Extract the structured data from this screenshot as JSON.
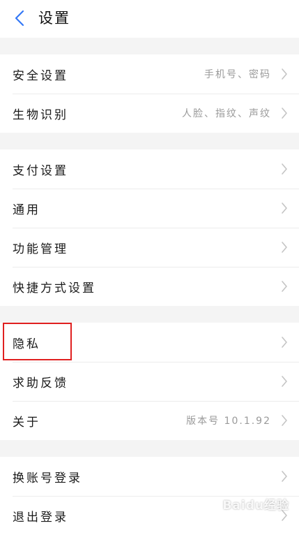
{
  "header": {
    "title": "设置"
  },
  "groups": [
    {
      "items": [
        {
          "label": "安全设置",
          "value": "手机号、密码"
        },
        {
          "label": "生物识别",
          "value": "人脸、指纹、声纹"
        }
      ]
    },
    {
      "items": [
        {
          "label": "支付设置",
          "value": ""
        },
        {
          "label": "通用",
          "value": ""
        },
        {
          "label": "功能管理",
          "value": ""
        },
        {
          "label": "快捷方式设置",
          "value": ""
        }
      ]
    },
    {
      "items": [
        {
          "label": "隐私",
          "value": ""
        },
        {
          "label": "求助反馈",
          "value": ""
        },
        {
          "label": "关于",
          "value": "版本号 10.1.92"
        }
      ]
    },
    {
      "items": [
        {
          "label": "换账号登录",
          "value": ""
        },
        {
          "label": "退出登录",
          "value": ""
        }
      ]
    }
  ],
  "colors": {
    "accent": "#3478f6",
    "highlight": "#e02020"
  },
  "watermark": "Baidu经验"
}
